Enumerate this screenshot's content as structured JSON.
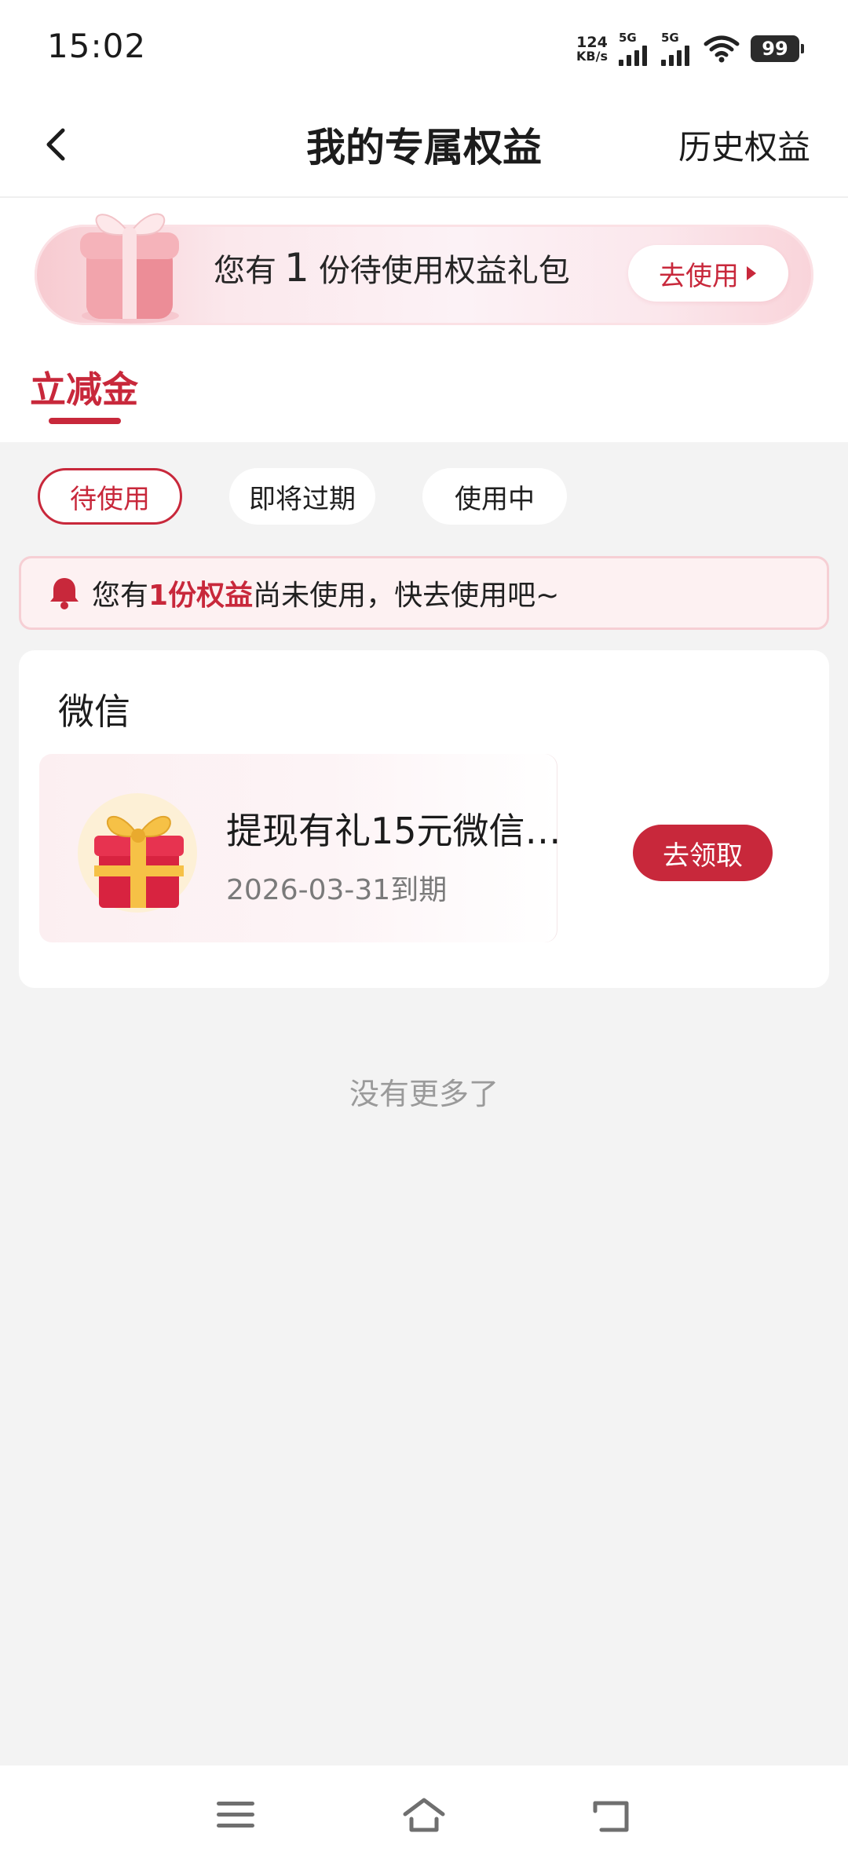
{
  "status_bar": {
    "time": "15:02",
    "net_speed_value": "124",
    "net_speed_unit": "KB/s",
    "sim1_label": "5G",
    "sim2_label": "5G",
    "battery": "99"
  },
  "header": {
    "title": "我的专属权益",
    "history_link": "历史权益",
    "back_icon": "chevron-left-icon"
  },
  "banner": {
    "text_prefix": "您有",
    "count": "1",
    "text_suffix": "份待使用权益礼包",
    "button_label": "去使用",
    "icon": "gift-box-icon"
  },
  "tabs": [
    {
      "label": "立减金",
      "active": true
    }
  ],
  "filters": [
    {
      "label": "待使用",
      "active": true
    },
    {
      "label": "即将过期",
      "active": false
    },
    {
      "label": "使用中",
      "active": false
    }
  ],
  "notice": {
    "prefix": "您有",
    "highlight": "1份权益",
    "suffix": "尚未使用，快去使用吧~",
    "icon": "bell-icon"
  },
  "section": {
    "title": "微信",
    "coupon": {
      "name": "提现有礼15元微信…",
      "expiry": "2026-03-31到期",
      "button_label": "去领取",
      "icon": "gift-box-icon"
    }
  },
  "footer_text": "没有更多了",
  "nav_bar": {
    "icons": [
      "menu-icon",
      "home-icon",
      "back-icon"
    ]
  },
  "colors": {
    "accent": "#c8283b",
    "page_bg": "#f3f3f3",
    "notice_bg": "#fdf1f2"
  }
}
